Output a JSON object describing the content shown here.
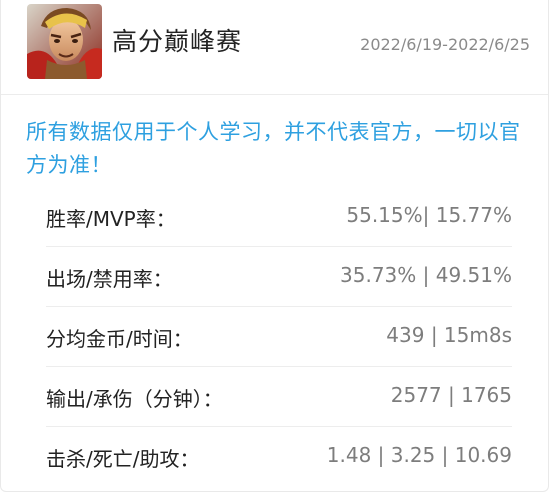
{
  "header": {
    "title": "高分巅峰赛",
    "date_range": "2022/6/19-2022/6/25",
    "avatar_icon": "hero-portrait-avatar"
  },
  "notice": "所有数据仅用于个人学习，并不代表官方，一切以官方为准！",
  "colors": {
    "notice": "#2ea0e0",
    "label": "#222222",
    "value": "#7d7d7d",
    "date": "#8a8a8a"
  },
  "stats": [
    {
      "label": "胜率/MVP率：",
      "value": "55.15%| 15.77%"
    },
    {
      "label": "出场/禁用率：",
      "value": "35.73% | 49.51%"
    },
    {
      "label": "分均金币/时间：",
      "value": "439 | 15m8s"
    },
    {
      "label": "输出/承伤（分钟）：",
      "value": "2577 | 1765"
    },
    {
      "label": "击杀/死亡/助攻：",
      "value": "1.48 | 3.25 | 10.69"
    }
  ]
}
